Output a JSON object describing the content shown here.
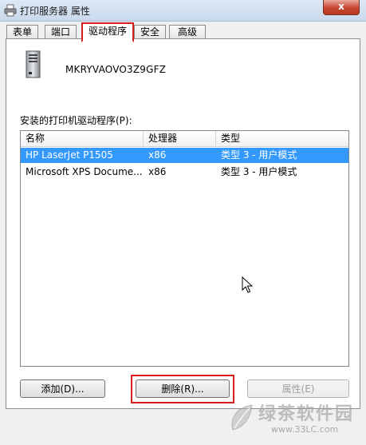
{
  "window": {
    "title": "打印服务器 属性",
    "close_label": "x"
  },
  "tabs": [
    {
      "label": "表单",
      "active": false
    },
    {
      "label": "端口",
      "active": false
    },
    {
      "label": "驱动程序",
      "active": true
    },
    {
      "label": "安全",
      "active": false
    },
    {
      "label": "高级",
      "active": false
    }
  ],
  "server": {
    "name": "MKRYVAOVO3Z9GFZ",
    "icon": "server-icon"
  },
  "drivers": {
    "label": "安装的打印机驱动程序(P):",
    "columns": [
      "名称",
      "处理器",
      "类型"
    ],
    "rows": [
      {
        "name": "HP LaserJet P1505",
        "processor": "x86",
        "type": "类型 3 - 用户模式",
        "selected": true
      },
      {
        "name": "Microsoft XPS Docume...",
        "processor": "x86",
        "type": "类型 3 - 用户模式",
        "selected": false
      }
    ]
  },
  "buttons": {
    "add": "添加(D)...",
    "remove": "删除(R)...",
    "properties": "属性(E)"
  },
  "watermark": {
    "brand": "绿茶软件园",
    "url": "www.33LC.com"
  },
  "colors": {
    "selection": "#3399ff",
    "highlight": "#d51f1f"
  }
}
